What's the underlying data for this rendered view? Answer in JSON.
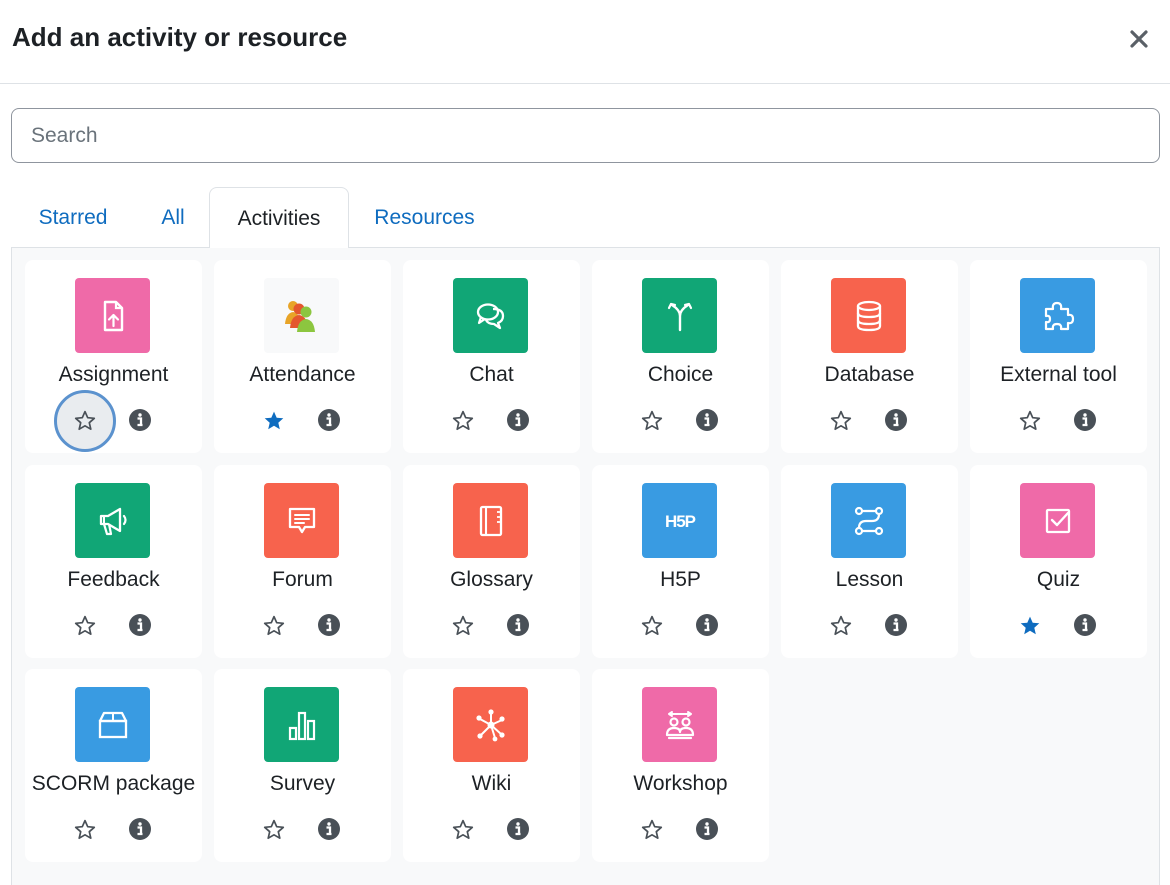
{
  "modal": {
    "title": "Add an activity or resource",
    "close_icon": "close-icon"
  },
  "search": {
    "placeholder": "Search",
    "value": ""
  },
  "tabs": [
    {
      "label": "Starred",
      "active": false
    },
    {
      "label": "All",
      "active": false
    },
    {
      "label": "Activities",
      "active": true
    },
    {
      "label": "Resources",
      "active": false
    }
  ],
  "colors": {
    "pink": "#ef6aa8",
    "green": "#11a676",
    "orange": "#f7634d",
    "blue": "#399be2",
    "link": "#0f6cbf",
    "star_filled": "#0f6cbf"
  },
  "activities": [
    {
      "name": "Assignment",
      "icon": "assignment-icon",
      "color": "#ef6aa8",
      "starred": false
    },
    {
      "name": "Attendance",
      "icon": "attendance-icon",
      "color": "#f8f9fa",
      "starred": true
    },
    {
      "name": "Chat",
      "icon": "chat-icon",
      "color": "#11a676",
      "starred": false
    },
    {
      "name": "Choice",
      "icon": "choice-icon",
      "color": "#11a676",
      "starred": false
    },
    {
      "name": "Database",
      "icon": "database-icon",
      "color": "#f7634d",
      "starred": false
    },
    {
      "name": "External tool",
      "icon": "puzzle-icon",
      "color": "#399be2",
      "starred": false
    },
    {
      "name": "Feedback",
      "icon": "megaphone-icon",
      "color": "#11a676",
      "starred": false
    },
    {
      "name": "Forum",
      "icon": "forum-icon",
      "color": "#f7634d",
      "starred": false
    },
    {
      "name": "Glossary",
      "icon": "book-icon",
      "color": "#f7634d",
      "starred": false
    },
    {
      "name": "H5P",
      "icon": "h5p-icon",
      "color": "#399be2",
      "starred": false
    },
    {
      "name": "Lesson",
      "icon": "lesson-icon",
      "color": "#399be2",
      "starred": false
    },
    {
      "name": "Quiz",
      "icon": "quiz-icon",
      "color": "#ef6aa8",
      "starred": true
    },
    {
      "name": "SCORM package",
      "icon": "package-icon",
      "color": "#399be2",
      "starred": false
    },
    {
      "name": "Survey",
      "icon": "bar-chart-icon",
      "color": "#11a676",
      "starred": false
    },
    {
      "name": "Wiki",
      "icon": "network-icon",
      "color": "#f7634d",
      "starred": false
    },
    {
      "name": "Workshop",
      "icon": "workshop-icon",
      "color": "#ef6aa8",
      "starred": false
    }
  ],
  "h5p_text": "H5P"
}
